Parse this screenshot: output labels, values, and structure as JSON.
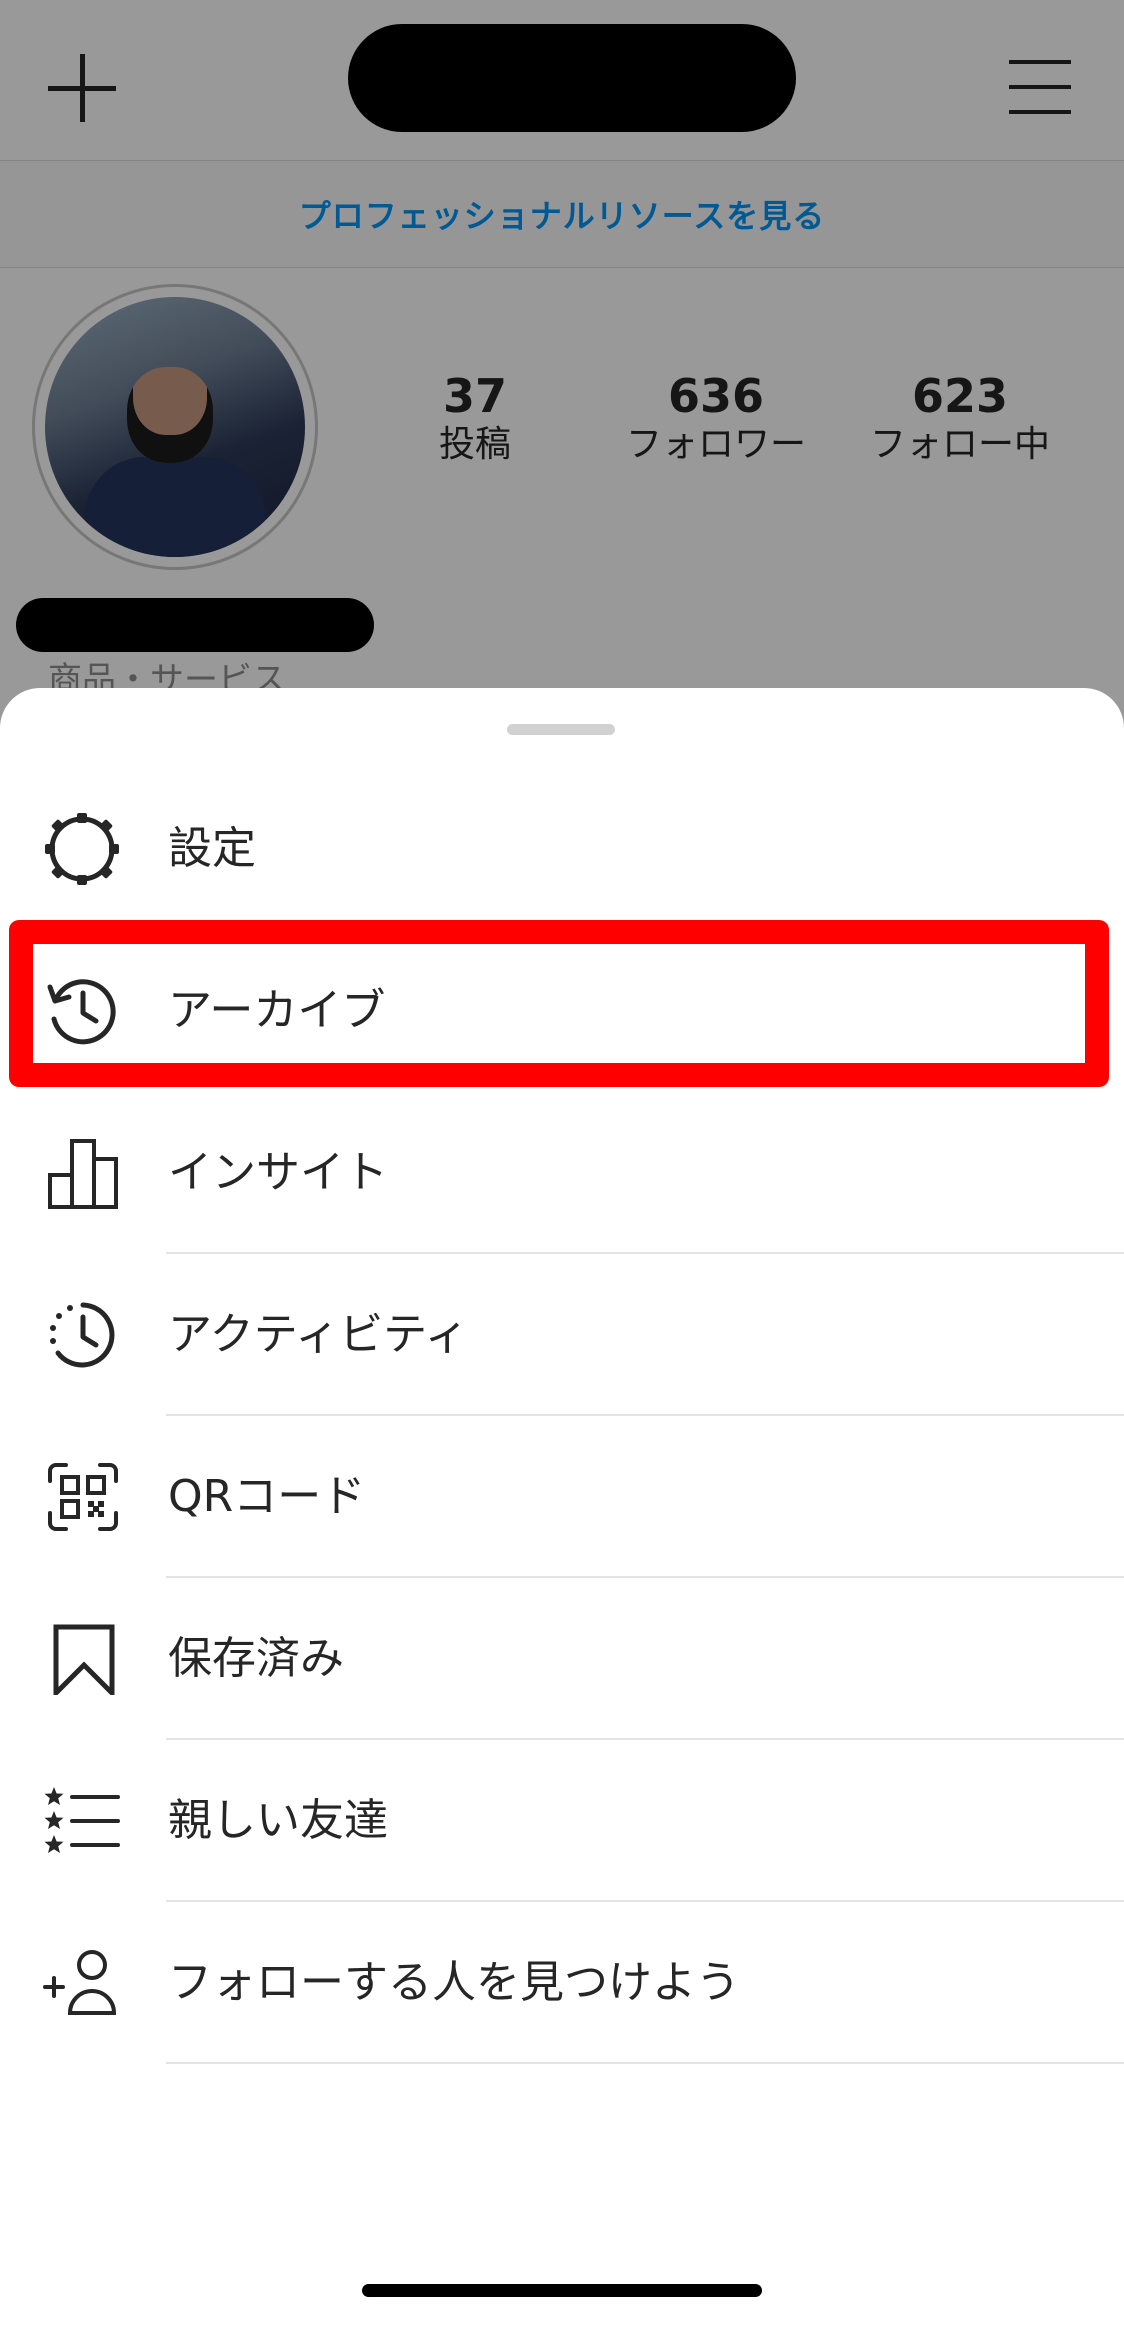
{
  "header": {
    "create_icon": "plus-icon",
    "menu_icon": "hamburger-menu-icon"
  },
  "professional_link": "プロフェッショナルリソースを見る",
  "profile": {
    "stats": [
      {
        "value": "37",
        "label": "投稿"
      },
      {
        "value": "636",
        "label": "フォロワー"
      },
      {
        "value": "623",
        "label": "フォロー中"
      }
    ],
    "category": "商品・サービス"
  },
  "menu": {
    "items": [
      {
        "label": "設定",
        "icon": "gear-icon"
      },
      {
        "label": "アーカイブ",
        "icon": "archive-clock-icon"
      },
      {
        "label": "インサイト",
        "icon": "bar-chart-icon"
      },
      {
        "label": "アクティビティ",
        "icon": "activity-clock-icon"
      },
      {
        "label": "QRコード",
        "icon": "qr-code-icon"
      },
      {
        "label": "保存済み",
        "icon": "bookmark-icon"
      },
      {
        "label": "親しい友達",
        "icon": "star-list-icon"
      },
      {
        "label": "フォローする人を見つけよう",
        "icon": "add-person-icon"
      }
    ]
  },
  "colors": {
    "highlight": "#ff0000",
    "link": "#0095f6",
    "text": "#262626"
  }
}
